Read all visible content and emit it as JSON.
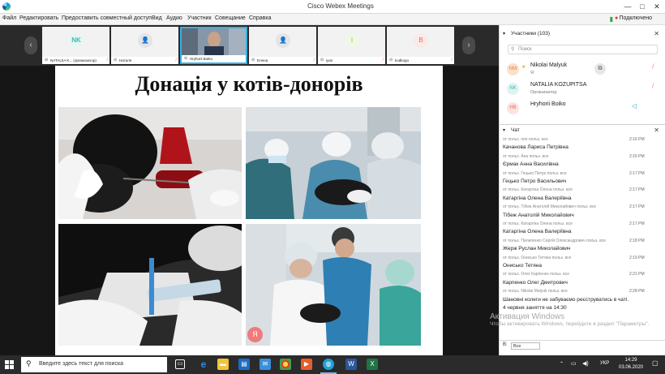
{
  "window": {
    "title": "Cisco Webex Meetings",
    "controls": [
      "—",
      "□",
      "✕"
    ]
  },
  "menu": {
    "items": [
      "Файл",
      "Редактировать",
      "Предоставить совместный доступ",
      "Вид",
      "Аудио",
      "Участник",
      "Совещание",
      "Справка"
    ],
    "connection": "Подключено"
  },
  "thumbnails": [
    {
      "initials": "NK",
      "name": "NATALIIA K... (организатор)",
      "color": "#3fb8b0",
      "style": "initials"
    },
    {
      "initials": "",
      "name": "Наталя",
      "color": "#c8c8c8",
      "style": "person"
    },
    {
      "initials": "",
      "name": "Hryhorii Boiko",
      "color": "#5a6b80",
      "style": "video"
    },
    {
      "initials": "",
      "name": "Елена",
      "color": "#c8c8c8",
      "style": "person"
    },
    {
      "initials": "I",
      "name": "iyan",
      "color": "#8dc63f",
      "style": "initials"
    },
    {
      "initials": "B",
      "name": "kodkogo",
      "color": "#e86c5d",
      "style": "initials"
    }
  ],
  "slide": {
    "title": "Донація у котів-донорів"
  },
  "avatar_y": "Я",
  "participants_panel": {
    "header": "Участники (103)",
    "search_placeholder": "Поиск",
    "list": [
      {
        "initials": "NM",
        "name": "Nikolai Malyuk",
        "role": "Я",
        "color": "#f3a76b"
      },
      {
        "initials": "NK",
        "name": "NATALIA KOZUPITSA",
        "role": "Организатор",
        "color": "#3fb8b0"
      },
      {
        "initials": "HB",
        "name": "Hryhorii Boiko",
        "role": "",
        "color": "#e86c5d"
      }
    ]
  },
  "chat": {
    "header": "Чат",
    "messages": [
      {
        "meta": "от польз. поп польз. все",
        "time": "2:16 PM",
        "text": ""
      },
      {
        "meta": "",
        "time": "",
        "text": "Качанова Лариса Петрівна"
      },
      {
        "meta": "от польз. Ана польз. все",
        "time": "2:16 PM",
        "text": ""
      },
      {
        "meta": "",
        "time": "",
        "text": "Єрмак Анна Василівна"
      },
      {
        "meta": "от польз. Гецько Петро польз. все",
        "time": "2:17 PM",
        "text": ""
      },
      {
        "meta": "",
        "time": "",
        "text": "Гецько Петро Васильович"
      },
      {
        "meta": "от польз. Катаргіна Олена польз. все",
        "time": "2:17 PM",
        "text": ""
      },
      {
        "meta": "",
        "time": "",
        "text": "Катаргіна Олена Валеріївна"
      },
      {
        "meta": "от польз. Тібеж Анатолій Миколайович польз. все",
        "time": "2:17 PM",
        "text": ""
      },
      {
        "meta": "",
        "time": "",
        "text": "Тібеж Анатолій Миколайович"
      },
      {
        "meta": "от польз. Катаргіна Олена польз. все",
        "time": "2:17 PM",
        "text": ""
      },
      {
        "meta": "",
        "time": "",
        "text": "Катаргіна Олена Валеріївна"
      },
      {
        "meta": "от польз. Пилипенко Сергій Олександрович польз. все",
        "time": "2:18 PM",
        "text": ""
      },
      {
        "meta": "",
        "time": "",
        "text": "Жерж Руслан Миколайович"
      },
      {
        "meta": "от польз. Онисько Тетяна польз. все",
        "time": "2:19 PM",
        "text": ""
      },
      {
        "meta": "",
        "time": "",
        "text": "Онисько Тетяна"
      },
      {
        "meta": "от польз. Олег Карпенко польз. все",
        "time": "2:21 PM",
        "text": ""
      },
      {
        "meta": "",
        "time": "",
        "text": "Карпенко Олег Дмитрович"
      },
      {
        "meta": "от польз. Nikolai Malyuk польз. все",
        "time": "2:28 PM",
        "text": ""
      },
      {
        "meta": "",
        "time": "",
        "text": "Шановні колеги не забуваємо реєструватись в чаті."
      },
      {
        "meta": "",
        "time": "",
        "text": "4 червня заняття на 14:30"
      }
    ],
    "to_label": "В:",
    "to_value": "Все"
  },
  "watermark": {
    "line1": "Активация Windows",
    "line2": "Чтобы активировать Windows, перейдите в раздел \"Параметры\"."
  },
  "taskbar": {
    "search_placeholder": "Введите здесь текст для поиска",
    "lang": "УКР",
    "time": "14:29",
    "date": "03.06.2020"
  },
  "colors": {
    "accent": "#1fa0d8",
    "mute_red": "#e33333",
    "taskbar": "#2b2b2b"
  }
}
